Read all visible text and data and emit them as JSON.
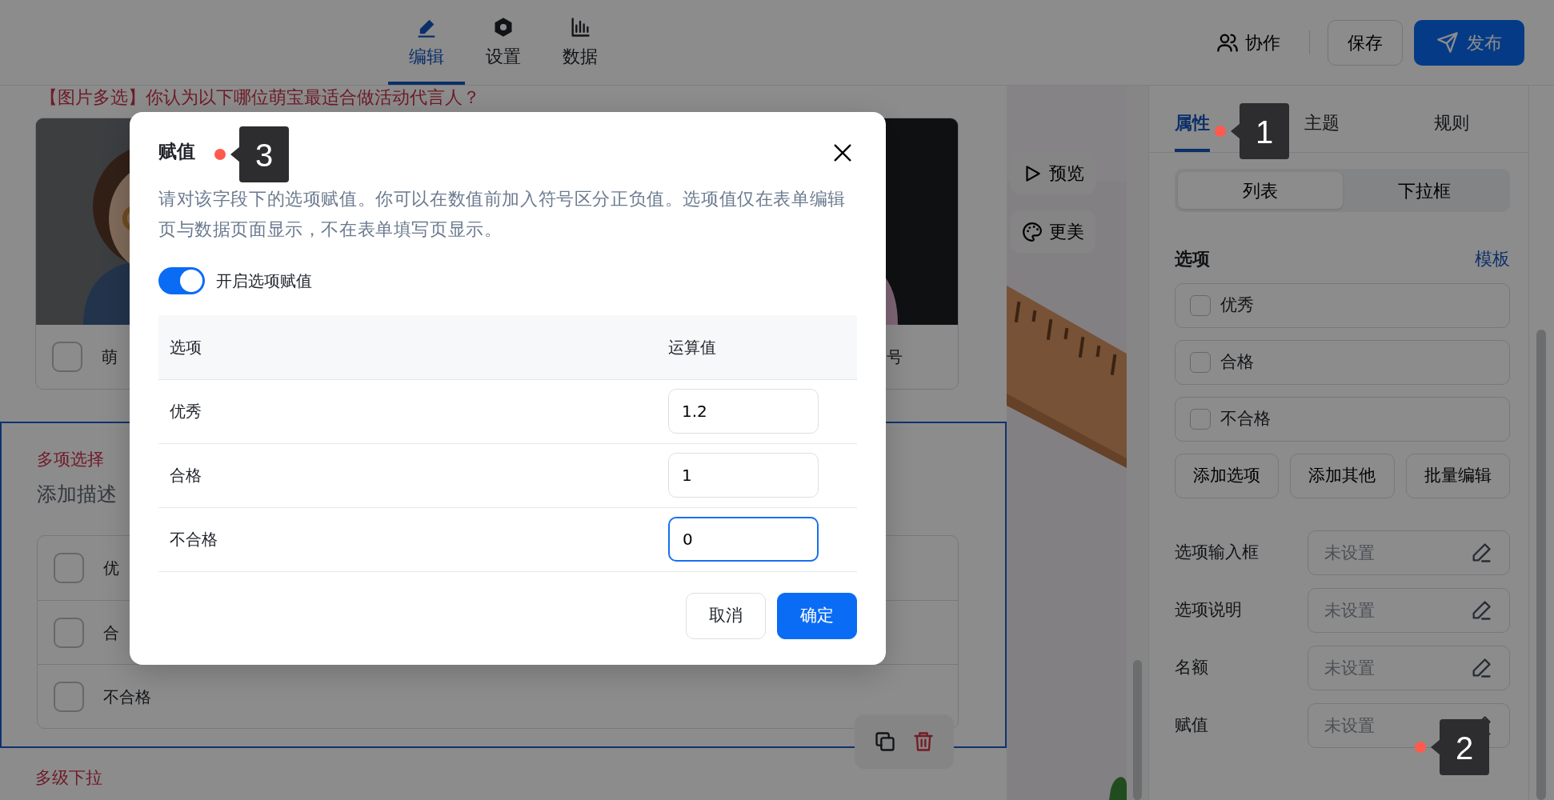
{
  "header": {
    "tabs": [
      {
        "label": "编辑",
        "selected": true
      },
      {
        "label": "设置",
        "selected": false
      },
      {
        "label": "数据",
        "selected": false
      }
    ],
    "collaborate": "协作",
    "save": "保存",
    "publish": "发布"
  },
  "form": {
    "question_title": "【图片多选】你认为以下哪位萌宝最适合做活动代言人？",
    "image_options": [
      {
        "label": "萌",
        "checked": false
      },
      {
        "label": "号"
      }
    ],
    "question": {
      "selected": true,
      "type_label": "多项选择",
      "description": "添加描述",
      "options": [
        {
          "label": "优",
          "checked": false
        },
        {
          "label": "合",
          "checked": false
        },
        {
          "label": "不合格",
          "checked": false
        }
      ]
    },
    "next_question": "多级下拉"
  },
  "canvas_tools": [
    "预览",
    "更美"
  ],
  "panel": {
    "tabs": [
      {
        "label": "属性",
        "selected": true
      },
      {
        "label": "主题",
        "selected": false
      },
      {
        "label": "规则",
        "selected": false
      }
    ],
    "display_modes": [
      {
        "label": "列表",
        "selected": true
      },
      {
        "label": "下拉框",
        "selected": false
      }
    ],
    "options_heading": "选项",
    "template_link": "模板",
    "options": [
      {
        "label": "优秀",
        "checked": false
      },
      {
        "label": "合格",
        "checked": false
      },
      {
        "label": "不合格",
        "checked": false
      }
    ],
    "buttons": [
      "添加选项",
      "添加其他",
      "批量编辑"
    ],
    "properties": [
      {
        "label": "选项输入框",
        "placeholder": "未设置"
      },
      {
        "label": "选项说明",
        "placeholder": "未设置"
      },
      {
        "label": "名额",
        "placeholder": "未设置"
      },
      {
        "label": "赋值",
        "placeholder": "未设置"
      }
    ]
  },
  "dialog": {
    "title": "赋值",
    "description": "请对该字段下的选项赋值。你可以在数值前加入符号区分正负值。选项值仅在表单编辑页与数据页面显示，不在表单填写页显示。",
    "toggle": {
      "label": "开启选项赋值",
      "on": true
    },
    "columns": [
      "选项",
      "运算值"
    ],
    "rows": [
      {
        "option": "优秀",
        "value": "1.2",
        "focused": false
      },
      {
        "option": "合格",
        "value": "1",
        "focused": false
      },
      {
        "option": "不合格",
        "value": "0",
        "focused": true
      }
    ],
    "buttons": [
      {
        "label": "取消",
        "kind": "secondary"
      },
      {
        "label": "确定",
        "kind": "primary"
      }
    ]
  },
  "markers": [
    {
      "number": "1"
    },
    {
      "number": "2"
    },
    {
      "number": "3"
    }
  ]
}
